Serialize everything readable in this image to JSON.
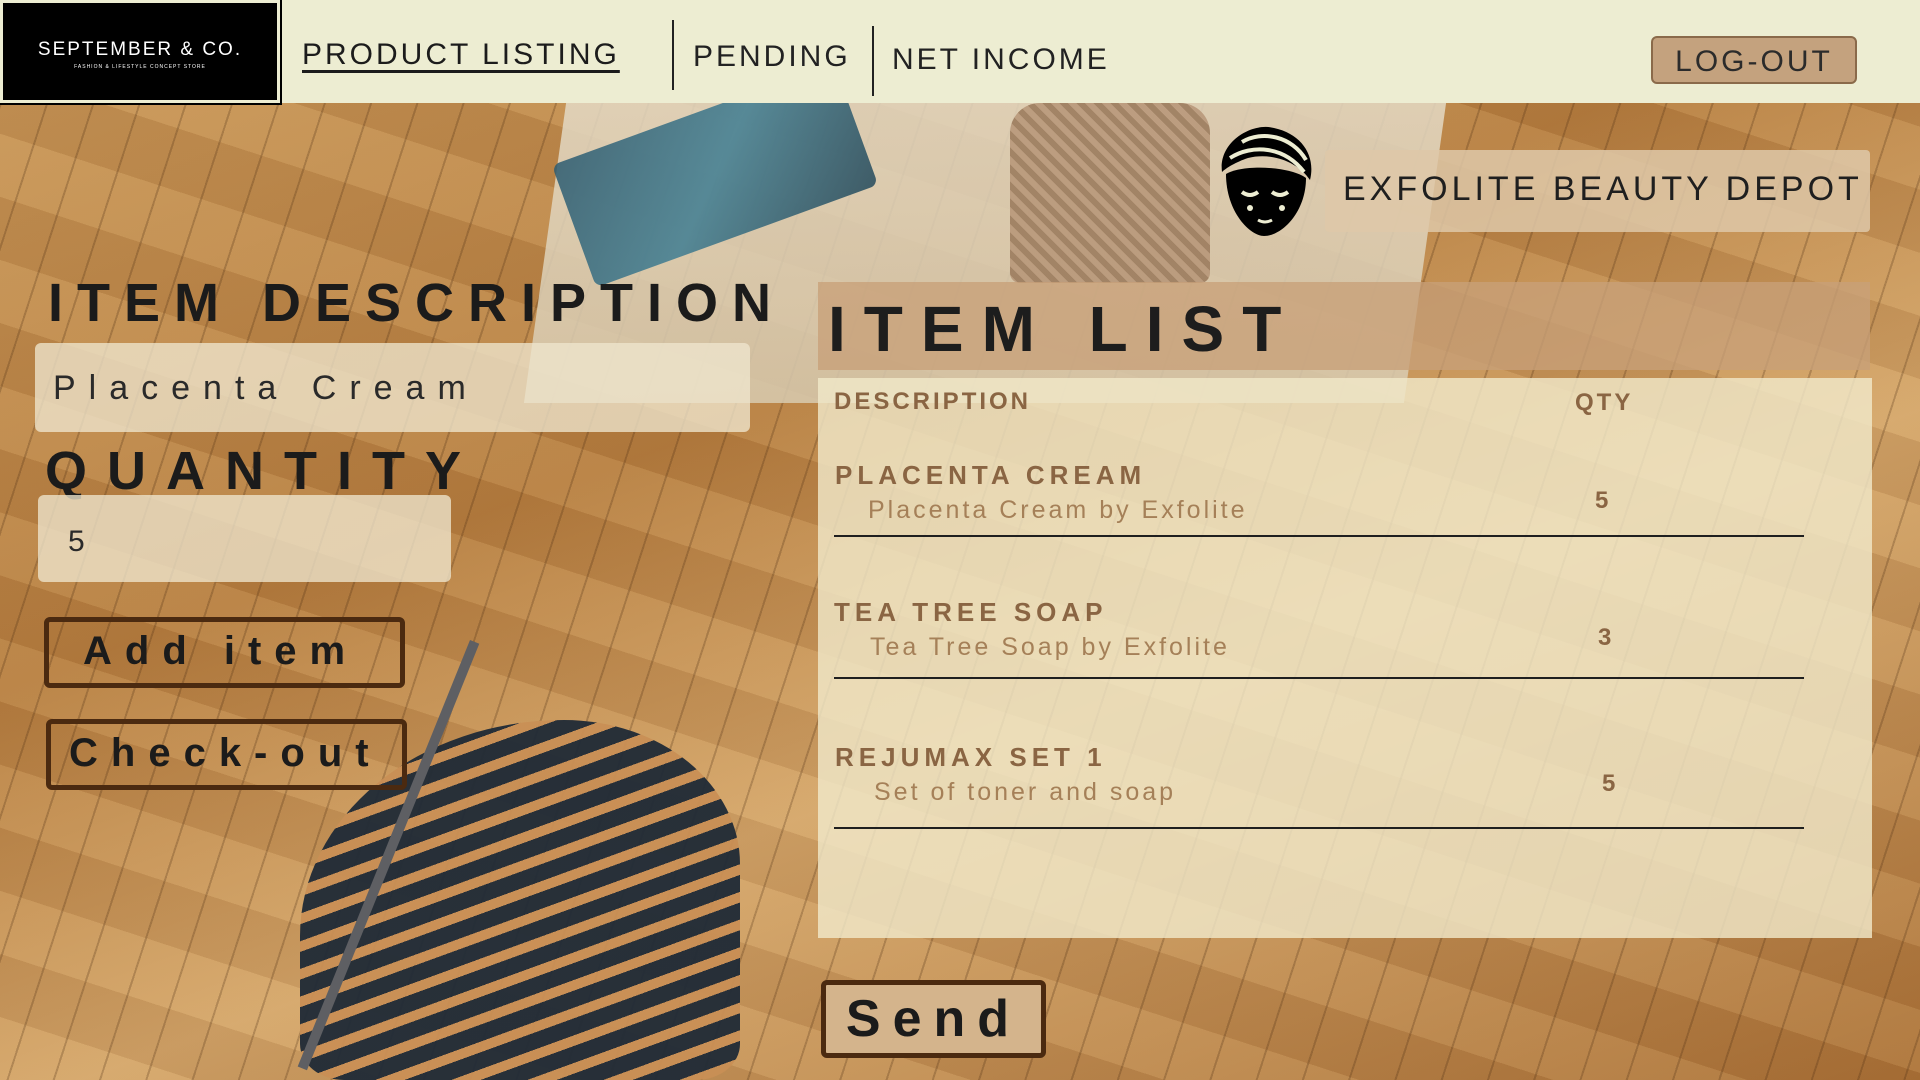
{
  "brand": {
    "name": "SEPTEMBER & CO.",
    "tagline": "FASHION & LIFESTYLE CONCEPT STORE"
  },
  "nav": {
    "items": [
      {
        "label": "PRODUCT LISTING",
        "active": true
      },
      {
        "label": "PENDING",
        "active": false
      },
      {
        "label": "NET INCOME",
        "active": false
      }
    ],
    "logout_label": "LOG-OUT"
  },
  "store": {
    "name": "EXFOLITE BEAUTY DEPOT",
    "icon": "face-mask-icon"
  },
  "form": {
    "description_label": "ITEM DESCRIPTION",
    "description_value": "Placenta Cream",
    "quantity_label": "QUANTITY",
    "quantity_value": "5",
    "add_label": "Add item",
    "checkout_label": "Check-out"
  },
  "item_list": {
    "title": "ITEM LIST",
    "columns": {
      "description": "DESCRIPTION",
      "qty": "QTY"
    },
    "rows": [
      {
        "name": "PLACENTA CREAM",
        "detail": "Placenta Cream by Exfolite",
        "qty": "5"
      },
      {
        "name": "TEA TREE SOAP",
        "detail": "Tea Tree Soap by Exfolite",
        "qty": "3"
      },
      {
        "name": "REJUMAX SET 1",
        "detail": "Set of toner and soap",
        "qty": "5"
      }
    ]
  },
  "send_label": "Send",
  "colors": {
    "topbar": "#ededd2",
    "accent_brown": "#4b2a10",
    "text_brown": "#8a6543",
    "panel": "#f0e8c8"
  }
}
